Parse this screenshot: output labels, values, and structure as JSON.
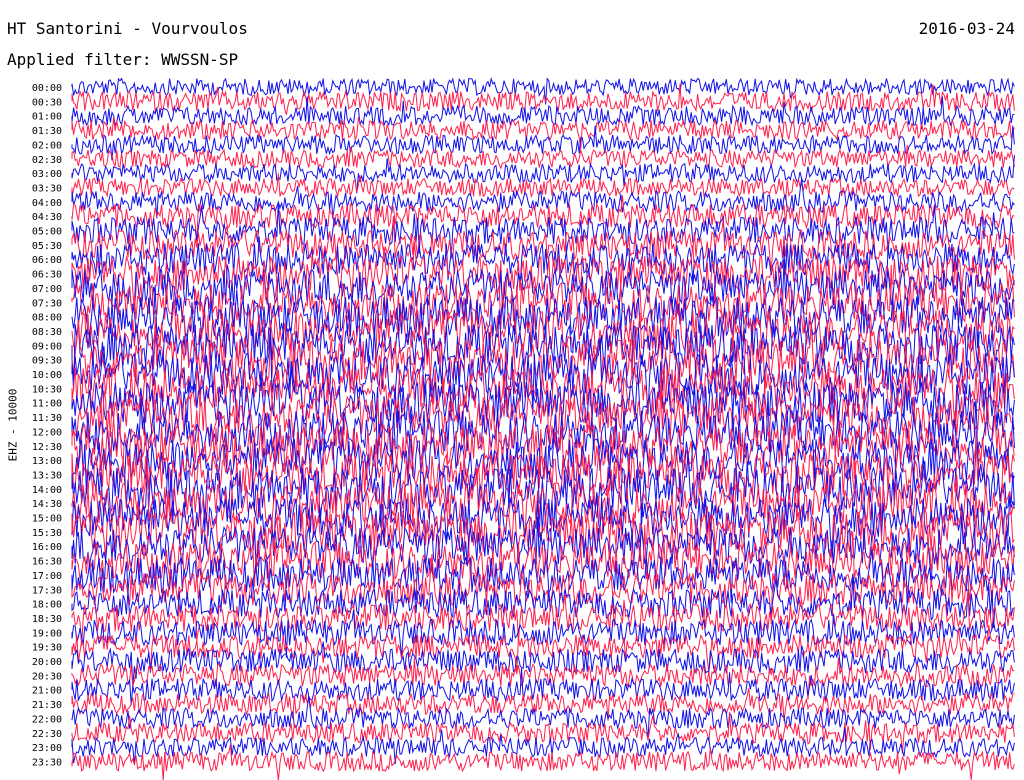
{
  "header": {
    "station": "HT Santorini - Vourvoulos",
    "date": "2016-03-24",
    "filter": "Applied filter: WWSSN-SP"
  },
  "axis": {
    "channel_label": "EHZ - 10000"
  },
  "colors": {
    "trace_a": "#1010e8",
    "trace_b": "#ff1f4a",
    "background": "#ffffff"
  },
  "chart_data": {
    "type": "line",
    "title": "HT Santorini - Vourvoulos",
    "subtitle": "Applied filter: WWSSN-SP",
    "ylabel": "EHZ - 10000",
    "rows": [
      "00:00",
      "00:30",
      "01:00",
      "01:30",
      "02:00",
      "02:30",
      "03:00",
      "03:30",
      "04:00",
      "04:30",
      "05:00",
      "05:30",
      "06:00",
      "06:30",
      "07:00",
      "07:30",
      "08:00",
      "08:30",
      "09:00",
      "09:30",
      "10:00",
      "10:30",
      "11:00",
      "11:30",
      "12:00",
      "12:30",
      "13:00",
      "13:30",
      "14:00",
      "14:30",
      "15:00",
      "15:30",
      "16:00",
      "16:30",
      "17:00",
      "17:30",
      "18:00",
      "18:30",
      "19:00",
      "19:30",
      "20:00",
      "20:30",
      "21:00",
      "21:30",
      "22:00",
      "22:30",
      "23:00",
      "23:30"
    ],
    "row_colors": [
      "trace_a",
      "trace_b"
    ],
    "relative_amplitude": [
      0.22,
      0.3,
      0.3,
      0.3,
      0.28,
      0.25,
      0.28,
      0.25,
      0.35,
      0.45,
      0.55,
      0.6,
      0.7,
      0.8,
      0.85,
      0.9,
      0.95,
      1.0,
      1.0,
      1.0,
      1.0,
      1.0,
      1.0,
      1.0,
      1.0,
      1.0,
      1.0,
      1.0,
      1.0,
      0.95,
      0.95,
      0.95,
      0.9,
      0.85,
      0.8,
      0.7,
      0.6,
      0.55,
      0.5,
      0.45,
      0.45,
      0.4,
      0.38,
      0.35,
      0.33,
      0.32,
      0.3,
      0.3
    ]
  }
}
